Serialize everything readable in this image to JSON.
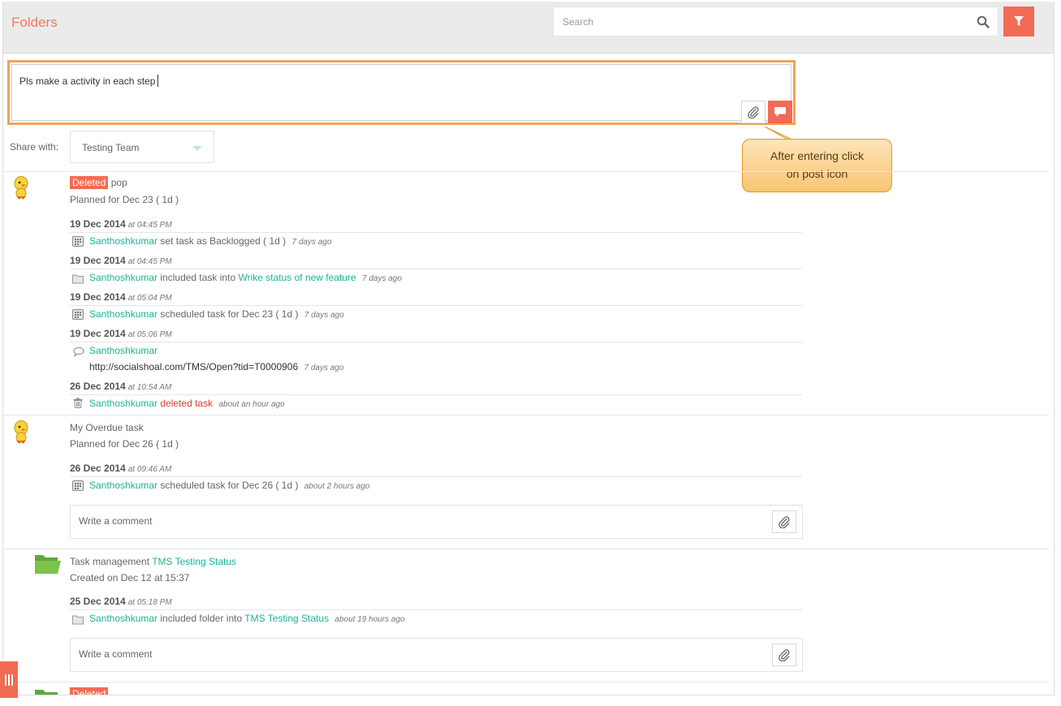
{
  "header": {
    "title": "Folders",
    "search_placeholder": "Search"
  },
  "composer": {
    "text": "Pls make a activity in each step",
    "share_label": "Share with:",
    "share_value": "Testing Team"
  },
  "callout": {
    "line1": "After entering click",
    "line2": "on post icon"
  },
  "feed": {
    "item1": {
      "badge": "Deleted",
      "title": "pop",
      "planned": "Planned for Dec 23 ( 1d )",
      "activities": [
        {
          "date": "19 Dec 2014",
          "time": "at 04:45 PM",
          "user": "Santhoshkumar",
          "action": "set task as Backlogged ( 1d )",
          "ago": "7 days ago"
        },
        {
          "date": "19 Dec 2014",
          "time": "at 04:45 PM",
          "user": "Santhoshkumar",
          "action": "included task into",
          "target": "Wrike status of new feature",
          "ago": "7 days ago"
        },
        {
          "date": "19 Dec 2014",
          "time": "at 05:04 PM",
          "user": "Santhoshkumar",
          "action": "scheduled task for Dec 23 ( 1d )",
          "ago": "7 days ago"
        },
        {
          "date": "19 Dec 2014",
          "time": "at 05:06 PM",
          "user": "Santhoshkumar",
          "comment": "http://socialshoal.com/TMS/Open?tid=T0000906",
          "ago": "7 days ago"
        },
        {
          "date": "26 Dec 2014",
          "time": "at 10:54 AM",
          "user": "Santhoshkumar",
          "action": "deleted task",
          "ago": "about an hour ago"
        }
      ]
    },
    "item2": {
      "title": "My Overdue task",
      "planned": "Planned for Dec 26 ( 1d )",
      "activities": [
        {
          "date": "26 Dec 2014",
          "time": "at 09:46 AM",
          "user": "Santhoshkumar",
          "action": "scheduled task for Dec 26 ( 1d )",
          "ago": "about 2 hours ago"
        }
      ],
      "comment_placeholder": "Write a comment"
    },
    "item3": {
      "prefix": "Task management",
      "folder": "TMS Testing Status",
      "created": "Created on Dec 12 at 15:37",
      "activities": [
        {
          "date": "25 Dec 2014",
          "time": "at 05:18 PM",
          "user": "Santhoshkumar",
          "action": "included folder into",
          "target": "TMS Testing Status",
          "ago": "about 19 hours ago"
        }
      ],
      "comment_placeholder": "Write a comment"
    },
    "item4": {
      "badge": "Deleted"
    }
  },
  "colors": {
    "accent": "#f26b54",
    "link": "#1ab394",
    "title": "#f07a5c"
  }
}
